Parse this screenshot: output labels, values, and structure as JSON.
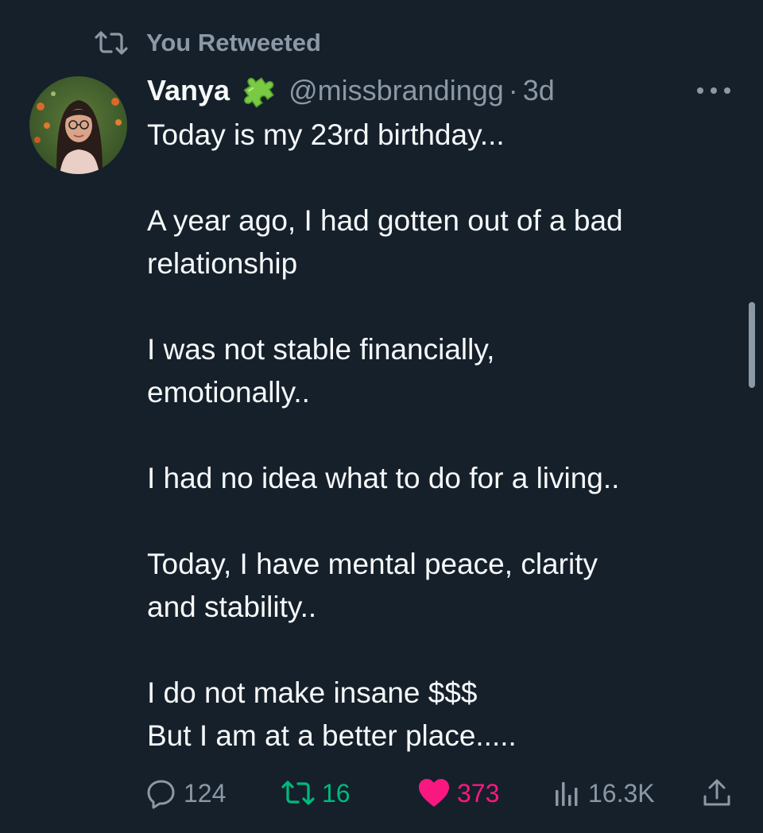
{
  "retweet_context": {
    "icon": "retweet-icon",
    "label": "You Retweeted"
  },
  "tweet": {
    "avatar": "user-avatar-photo",
    "display_name": "Vanya",
    "badge_icon": "puzzle-piece-icon",
    "badge_color": "#7ac943",
    "handle": "@missbrandingg",
    "separator": "·",
    "time": "3d",
    "more_icon": "more-options-icon",
    "paragraphs": [
      [
        "Today is my 23rd birthday..."
      ],
      [
        "A year ago, I had gotten out of a bad",
        "relationship"
      ],
      [
        "I was not stable financially,",
        "emotionally.."
      ],
      [
        "I had no idea what to do for a living.."
      ],
      [
        "Today, I have mental peace, clarity",
        "and stability.."
      ],
      [
        "I do not make insane $$$",
        "But I am at a better place....."
      ]
    ]
  },
  "actions": {
    "reply": {
      "icon": "reply-icon",
      "count": "124"
    },
    "retweet": {
      "icon": "retweet-icon",
      "count": "16",
      "active": true,
      "color": "#00ba7c"
    },
    "like": {
      "icon": "heart-icon",
      "count": "373",
      "active": true,
      "color": "#f91880"
    },
    "views": {
      "icon": "views-chart-icon",
      "count": "16.3K"
    },
    "share": {
      "icon": "share-icon"
    }
  },
  "colors": {
    "background": "#15202b",
    "primary_text": "#f7f9f9",
    "secondary_text": "#8b98a5"
  }
}
